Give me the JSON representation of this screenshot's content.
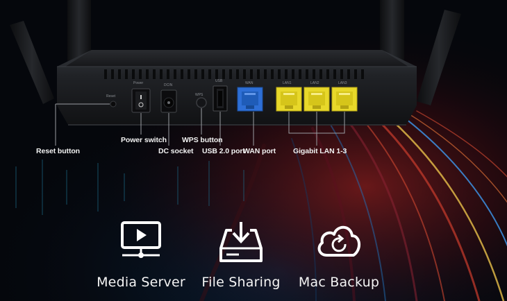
{
  "router": {
    "port_labels": {
      "reset": "Reset",
      "power": "Power",
      "dc": "DCIN",
      "wps": "WPS",
      "usb": "USB",
      "wan": "WAN",
      "lan1": "LAN1",
      "lan2": "LAN2",
      "lan3": "LAN3"
    }
  },
  "callouts": {
    "reset": "Reset button",
    "power": "Power switch",
    "dc": "DC socket",
    "wps": "WPS button",
    "usb": "USB 2.0 port",
    "wan": "WAN port",
    "lan": "Gigabit LAN 1-3"
  },
  "features": [
    {
      "label": "Media Server",
      "icon": "media-server-icon"
    },
    {
      "label": "File Sharing",
      "icon": "file-sharing-icon"
    },
    {
      "label": "Mac Backup",
      "icon": "mac-backup-icon"
    }
  ],
  "colors": {
    "background": "#05070c",
    "wan_port": "#2e6fd6",
    "lan_port": "#e8d82a",
    "text": "#ffffff"
  }
}
